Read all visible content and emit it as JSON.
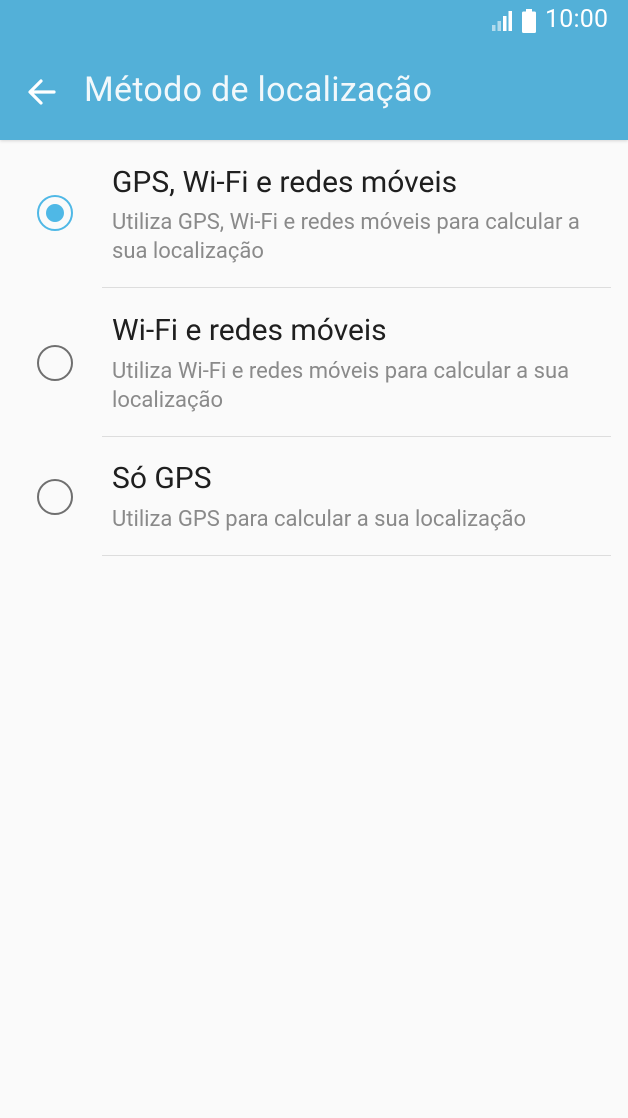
{
  "status_bar": {
    "time": "10:00",
    "signal_icon": "signal-icon",
    "battery_icon": "battery-icon"
  },
  "header": {
    "back_icon": "arrow-back-icon",
    "title": "Método de localização"
  },
  "options": [
    {
      "title": "GPS, Wi-Fi e redes móveis",
      "description": "Utiliza GPS, Wi-Fi e redes móveis para calcular a sua localização",
      "selected": true
    },
    {
      "title": "Wi-Fi e redes móveis",
      "description": "Utiliza Wi-Fi e redes móveis para calcular a sua localização",
      "selected": false
    },
    {
      "title": "Só GPS",
      "description": "Utiliza GPS para calcular a sua localização",
      "selected": false
    }
  ],
  "colors": {
    "header": "#53b0d8",
    "accent": "#4fb8e6",
    "background": "#fafafa"
  }
}
